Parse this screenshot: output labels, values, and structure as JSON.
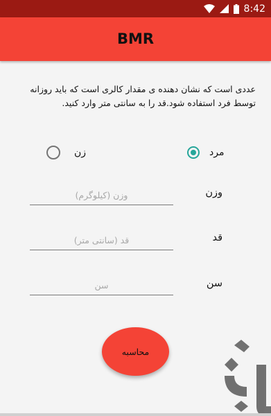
{
  "status_bar": {
    "time": "8:42",
    "icons": [
      "wifi-icon",
      "cell-signal-icon",
      "battery-icon"
    ],
    "color": "#9b1a13"
  },
  "app_bar": {
    "title": "BMR",
    "color": "#f44336"
  },
  "description": "عددی است که نشان دهنده ی مقدار کالری است که باید روزانه توسط فرد استفاده شود.قد را به سانتی متر وارد کنید.",
  "gender": {
    "options": [
      {
        "label": "مرد",
        "checked": true
      },
      {
        "label": "زن",
        "checked": false
      }
    ],
    "accent_color": "#26a69a"
  },
  "fields": {
    "weight": {
      "label": "وزن",
      "placeholder": "وزن (کیلوگرم)",
      "value": ""
    },
    "height": {
      "label": "قد",
      "placeholder": "قد (سانتی متر)",
      "value": ""
    },
    "age": {
      "label": "سن",
      "placeholder": "سن",
      "value": ""
    }
  },
  "calculate_button": {
    "label": "محاسبه",
    "color": "#f44336"
  },
  "watermark": {
    "icon": "bazaar-logo-icon"
  }
}
